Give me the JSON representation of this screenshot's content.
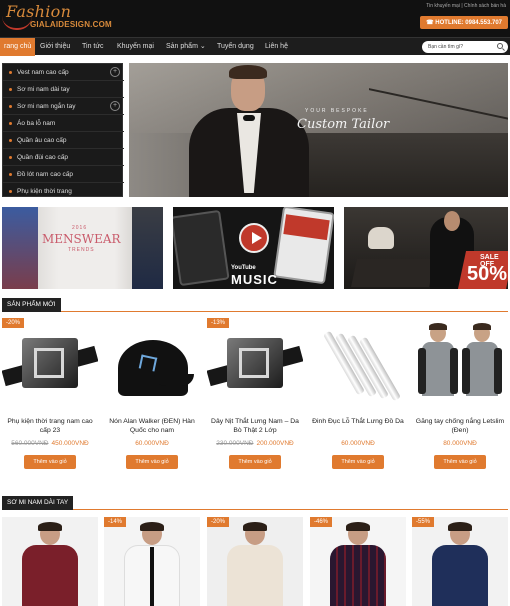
{
  "header": {
    "logo_script": "Fashion",
    "logo_domain": "GIALAIDESIGN.COM",
    "top_links": "Tin khuyến mại | Chính sách bán hà",
    "hotline": "HOTLINE: 0984.553.707"
  },
  "nav": {
    "items": [
      "rang chủ",
      "Giới thiệu",
      "Tin tức",
      "Khuyến mại",
      "Sản phẩm",
      "Tuyển dụng",
      "Liên hệ"
    ],
    "search_placeholder": "Bạn cần tìm gì?"
  },
  "sidebar": {
    "items": [
      "Vest nam cao cấp",
      "Sơ mi nam dài tay",
      "Sơ mi nam ngắn tay",
      "Áo ba lỗ nam",
      "Quần âu cao cấp",
      "Quần đùi cao cấp",
      "Đồ lót nam cao cấp",
      "Phụ kiện thời trang"
    ]
  },
  "hero": {
    "line1": "YOUR BESPOKE",
    "line2": "Custom Tailor"
  },
  "banners": {
    "b1_year": "2016",
    "b1_title": "MENSWEAR",
    "b1_sub": "TRENDS",
    "b2_brand": "YouTube",
    "b2_title": "MUSIC",
    "b3_off": "SALE OFF",
    "b3_pct": "50%"
  },
  "sections": {
    "new_products": "SẢN PHẨM MỚI",
    "long_sleeve": "SƠ MI NAM DÀI TAY"
  },
  "products": [
    {
      "badge": "-20%",
      "name": "Phụ kiện thời trang nam cao cấp 23",
      "old_price": "560.000VNĐ",
      "price": "450.000VNĐ",
      "button": "Thêm vào giỏ"
    },
    {
      "badge": "",
      "name": "Nón Alan Walker (ĐEN) Hàn Quốc cho nam",
      "old_price": "",
      "price": "60.000VNĐ",
      "button": "Thêm vào giỏ"
    },
    {
      "badge": "-13%",
      "name": "Dây Nịt Thắt Lưng Nam – Da Bò Thật 2 Lớp",
      "old_price": "230.000VNĐ",
      "price": "200.000VNĐ",
      "button": "Thêm vào giỏ"
    },
    {
      "badge": "",
      "name": "Đinh Đục Lỗ Thắt Lưng Đồ Da",
      "old_price": "",
      "price": "60.000VNĐ",
      "button": "Thêm vào giỏ"
    },
    {
      "badge": "",
      "name": "Găng tay chống nắng Letslim (Đen)",
      "old_price": "",
      "price": "80.000VNĐ",
      "button": "Thêm vào giỏ"
    }
  ],
  "products_row2": [
    {
      "badge": ""
    },
    {
      "badge": "-14%"
    },
    {
      "badge": "-20%"
    },
    {
      "badge": "-46%"
    },
    {
      "badge": "-55%"
    }
  ],
  "colors": {
    "accent": "#e07a2f",
    "header_bg": "#111111",
    "sale_red": "#c0392b"
  }
}
